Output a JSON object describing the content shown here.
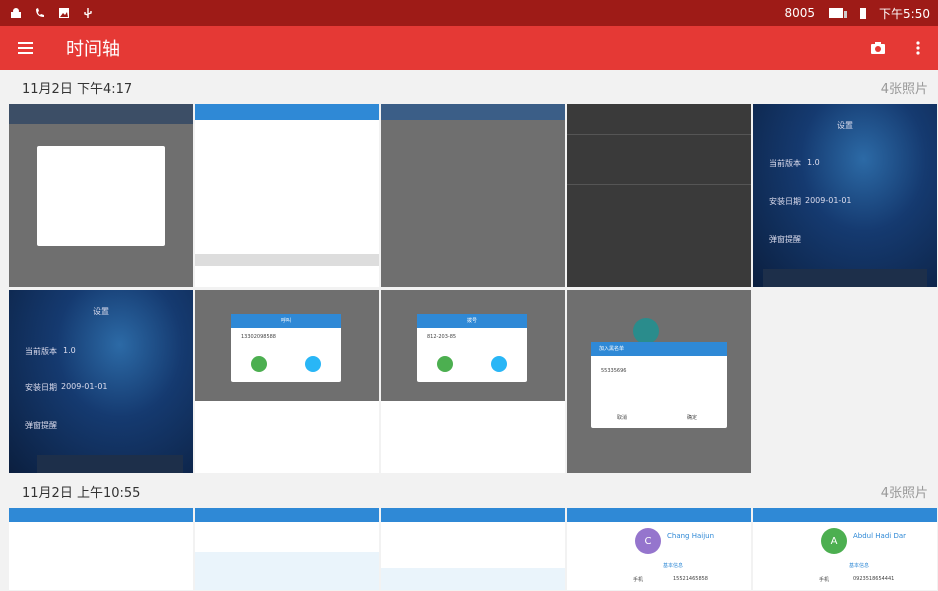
{
  "status_bar": {
    "code": "8005",
    "time": "下午5:50"
  },
  "app_bar": {
    "title": "时间轴",
    "menu_icon": "hamburger-menu-icon",
    "camera_icon": "camera-icon",
    "more_icon": "more-vertical-icon"
  },
  "sections": [
    {
      "date": "11月2日 下午4:17",
      "count": "4张照片"
    },
    {
      "date": "11月2日 上午10:55",
      "count": "4张照片"
    }
  ],
  "thumbs": {
    "settings": {
      "title": "设置",
      "version_label": "当前版本",
      "version": "1.0",
      "install_label": "安装日期",
      "install_date": "2009-01-01",
      "popup_label": "弹窗提醒"
    },
    "dial_1": {
      "title": "呼叫",
      "number": "13302098588"
    },
    "dial_2": {
      "title": "拨号",
      "number": "812-203-85"
    },
    "blacklist": {
      "title": "加入黑名单",
      "number": "55335696",
      "cancel": "取消",
      "confirm": "确定"
    },
    "contact_1": {
      "initial": "C",
      "name": "Chang Haijun",
      "section": "基本信息",
      "label": "手机",
      "phone": "15521465858"
    },
    "contact_2": {
      "initial": "A",
      "name": "Abdul Hadi Dar",
      "section": "基本信息",
      "label": "手机",
      "phone": "0923518654441"
    }
  },
  "colors": {
    "status_bar": "#9e1b17",
    "app_bar": "#e53935",
    "accent_blue": "#2f89d6"
  }
}
